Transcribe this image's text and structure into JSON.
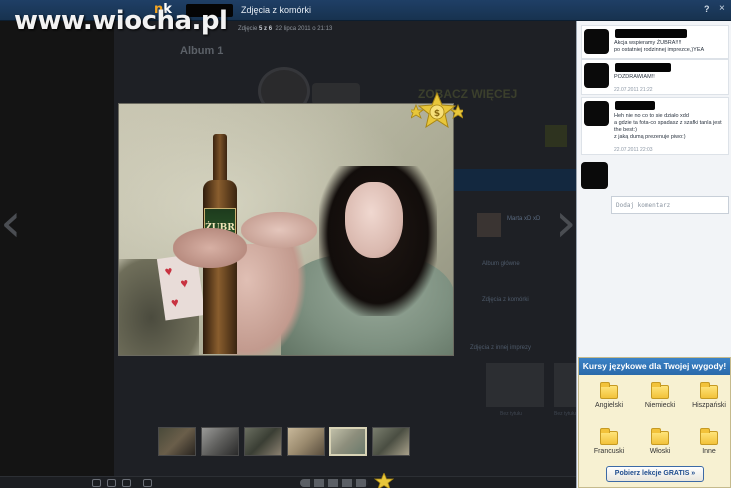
{
  "watermark": {
    "text": "www.wiocha.pl"
  },
  "topbar": {
    "logo_n": "n",
    "logo_k": "k",
    "title": "Zdjęcia z komórki",
    "help_label": "?",
    "close_label": "×"
  },
  "background_page": {
    "counter_prefix": "Zdjęcie",
    "counter_current": "5",
    "counter_sep": "z",
    "counter_total": "6",
    "counter_date": "22 lipca 2011 o 21:13",
    "heading": "Album 1",
    "ad_text": "ZOBACZ WIĘCEJ",
    "profile_name": "Marta xD xD",
    "links": [
      "Album główne",
      "Zdjęcia z komórki",
      "Zdjęcia z innej imprezy"
    ],
    "thumb_captions": [
      "Bez tytułu",
      "Bez tytułu"
    ]
  },
  "nav": {
    "prev": "‹",
    "next": "›"
  },
  "bottle_label": "ŻUBR",
  "thumbnails": [
    {
      "colors": [
        "#4a4a3a",
        "#6a5e4a",
        "#2a2520"
      ],
      "active": false
    },
    {
      "colors": [
        "#9a9a98",
        "#5e5e5c",
        "#2a2a2a"
      ],
      "active": false
    },
    {
      "colors": [
        "#6a6e60",
        "#3a3e34",
        "#8a8070"
      ],
      "active": false
    },
    {
      "colors": [
        "#c8b89a",
        "#9a8a6e",
        "#5a4e3e"
      ],
      "active": false
    },
    {
      "colors": [
        "#c0bfa8",
        "#8d8e7c",
        "#6a7a6c"
      ],
      "active": true
    },
    {
      "colors": [
        "#7a7e6e",
        "#4a4e42",
        "#a8a08a"
      ],
      "active": false
    }
  ],
  "comments": [
    {
      "text": "Akcja wspieramy ŻUBRA!!!!\npo ostatniej rodzinnej imprezce,)YEA",
      "date": ""
    },
    {
      "text": "POZDRAWIAM!!",
      "date": "22.07.2011 21:22"
    },
    {
      "text": "Heh nie no co to sie działo xdd\na gdzie ta fota-co spadasz z szafki tanla jest the best:)\nz jaką dumą prezenuje piwo:)",
      "date": "22.07.2011 22:03"
    }
  ],
  "comment_input": {
    "placeholder": "Dodaj komentarz"
  },
  "ad": {
    "header": "Kursy językowe dla Twojej wygody!",
    "languages": [
      "Angielski",
      "Niemiecki",
      "Hiszpański",
      "Francuski",
      "Włoski",
      "Inne"
    ],
    "cta": "Pobierz lekcje GRATIS »"
  },
  "colors": {
    "topbar": "#1f3f66",
    "panel_bg": "#f2f4f7",
    "ad_header": "#3c82c6",
    "ad_bg": "#f7f1d2"
  }
}
